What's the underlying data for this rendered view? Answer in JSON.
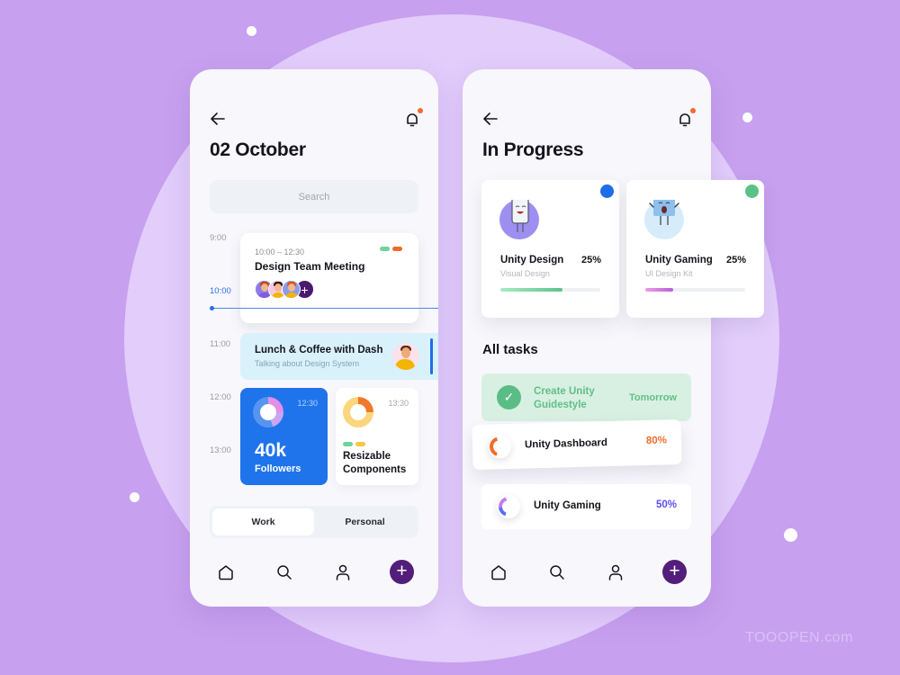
{
  "background": {
    "watermark": "TOOOPEN.com"
  },
  "left_screen": {
    "title": "02 October",
    "search_placeholder": "Search",
    "times": [
      "9:00",
      "10:00",
      "11:00",
      "12:00",
      "13:00"
    ],
    "current_time": "10:00",
    "meeting": {
      "time_range": "10:00 – 12:30",
      "title": "Design Team Meeting",
      "tag_colors": [
        "#6fd39a",
        "#f26b2a"
      ],
      "participants": 3,
      "add_label": "+"
    },
    "lunch": {
      "title": "Lunch & Coffee with Dash",
      "subtitle": "Talking about Design System"
    },
    "followers_card": {
      "time": "12:30",
      "value": "40k",
      "label": "Followers"
    },
    "resizable_card": {
      "time": "13:30",
      "title": "Resizable Components",
      "tag_colors": [
        "#6fd39a",
        "#f5c842"
      ]
    },
    "segment": {
      "options": [
        "Work",
        "Personal"
      ],
      "selected": "Work"
    }
  },
  "right_screen": {
    "title": "In Progress",
    "projects": [
      {
        "name": "Unity Design",
        "subtitle": "Visual Design",
        "percent": "25%",
        "progress": 0.62,
        "status_color": "#1f6de8"
      },
      {
        "name": "Unity Gaming",
        "subtitle": "UI Design Kit",
        "percent": "25%",
        "progress": 0.28,
        "status_color": "#5bc189"
      }
    ],
    "section_title": "All tasks",
    "tasks": [
      {
        "name": "Create Unity Guidestyle",
        "due": "Tomorrow",
        "done": true
      },
      {
        "name": "Unity Dashboard",
        "percent": "80%",
        "color": "#f26b2a"
      },
      {
        "name": "Unity Gaming",
        "percent": "50%",
        "color": "#5a4ff0"
      }
    ]
  },
  "navbar": {
    "items": [
      "home",
      "search",
      "profile",
      "add"
    ],
    "add_label": "+"
  }
}
